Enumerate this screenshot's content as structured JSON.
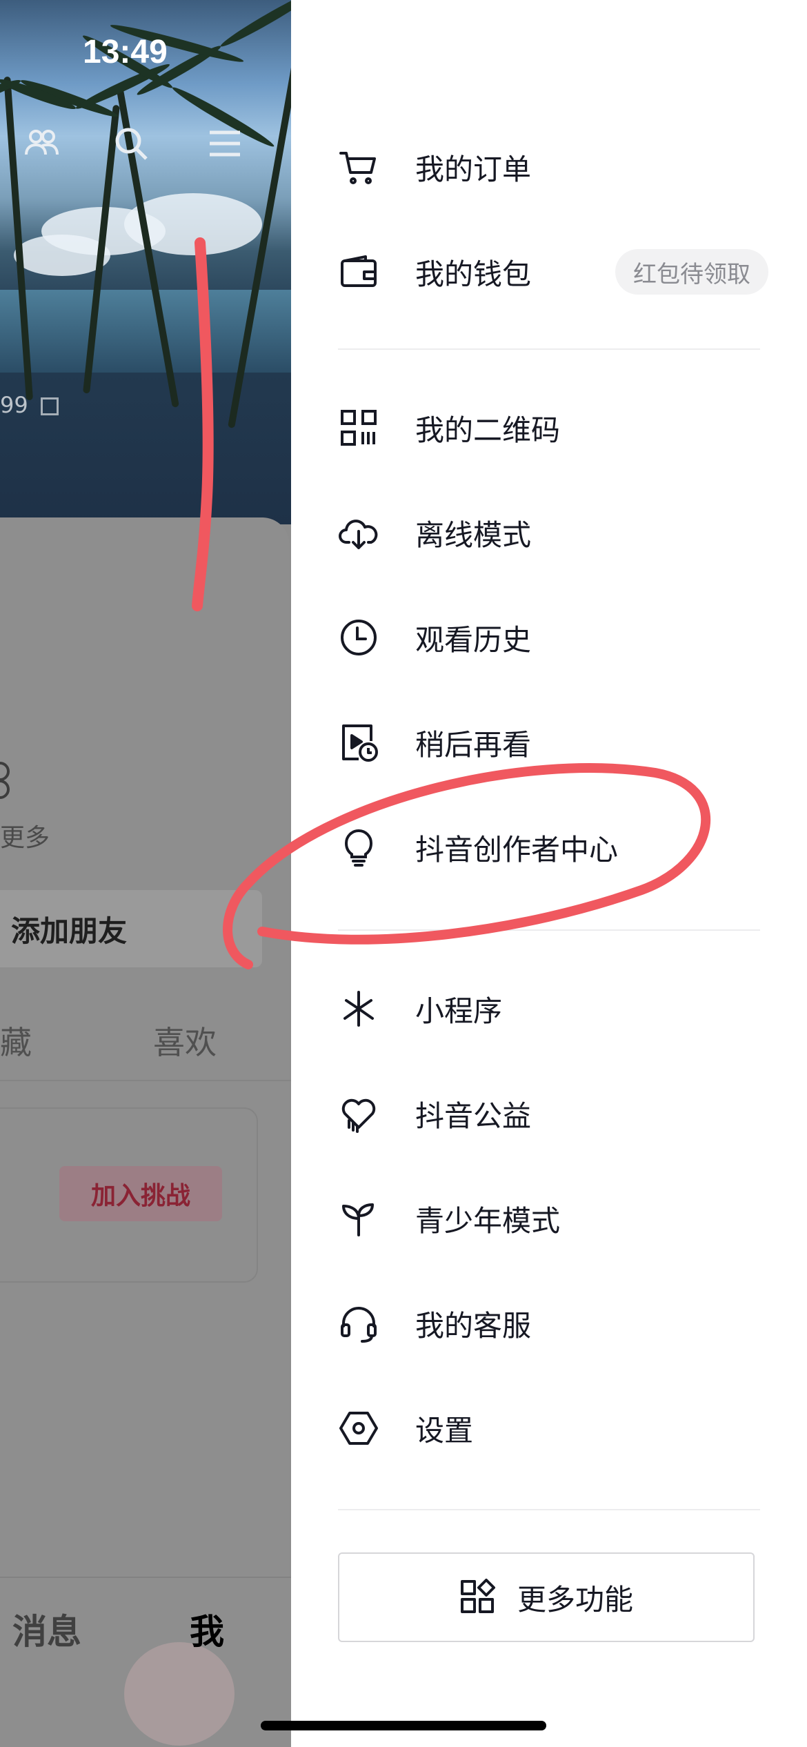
{
  "status_bar": {
    "time": "13:49"
  },
  "left_page": {
    "hero_id_fragment": "99",
    "more_text": "更多",
    "add_friend_label": "添加朋友",
    "tabs": {
      "collect": "藏",
      "like": "喜欢"
    },
    "challenge_button": "加入挑战",
    "bottom_nav": {
      "messages": "消息",
      "me": "我"
    }
  },
  "menu": {
    "group1": [
      {
        "label": "我的订单",
        "icon": "cart-icon"
      },
      {
        "label": "我的钱包",
        "icon": "wallet-icon",
        "badge": "红包待领取"
      }
    ],
    "group2": [
      {
        "label": "我的二维码",
        "icon": "qr-code-icon"
      },
      {
        "label": "离线模式",
        "icon": "cloud-download-icon"
      },
      {
        "label": "观看历史",
        "icon": "clock-icon"
      },
      {
        "label": "稍后再看",
        "icon": "watch-later-icon"
      },
      {
        "label": "抖音创作者中心",
        "icon": "lightbulb-icon"
      }
    ],
    "group3": [
      {
        "label": "小程序",
        "icon": "mini-program-icon"
      },
      {
        "label": "抖音公益",
        "icon": "charity-heart-icon"
      },
      {
        "label": "青少年模式",
        "icon": "sprout-icon"
      },
      {
        "label": "我的客服",
        "icon": "headset-icon"
      },
      {
        "label": "设置",
        "icon": "settings-hexagon-icon"
      }
    ],
    "more_button": "更多功能"
  },
  "colors": {
    "annotation_red": "#f0585f",
    "menu_text": "#161823",
    "badge_bg": "#f2f2f3",
    "dim_overlay": "#8c8c8c"
  }
}
